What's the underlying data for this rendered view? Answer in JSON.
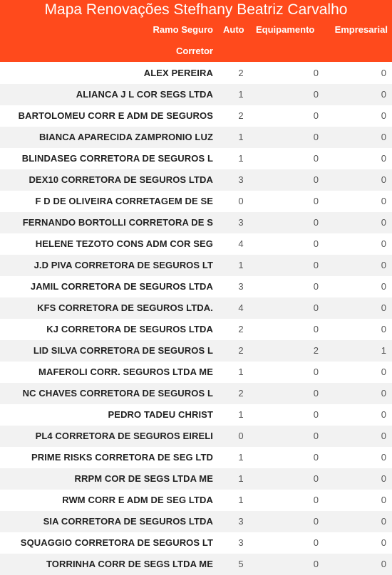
{
  "title": "Mapa Renovações Stefhany Beatriz Carvalho",
  "colors": {
    "accent": "#ff4a1c",
    "row_alt": "#f2f2f2"
  },
  "header": {
    "ramo": "Ramo Seguro",
    "auto": "Auto",
    "equipamento": "Equipamento",
    "empresarial": "Empresarial",
    "corretor": "Corretor"
  },
  "rows": [
    {
      "corretor": "ALEX PEREIRA",
      "auto": "2",
      "equipamento": "0",
      "empresarial": "0"
    },
    {
      "corretor": "ALIANCA J L COR SEGS LTDA",
      "auto": "1",
      "equipamento": "0",
      "empresarial": "0"
    },
    {
      "corretor": "BARTOLOMEU CORR E ADM DE SEGUROS",
      "auto": "2",
      "equipamento": "0",
      "empresarial": "0"
    },
    {
      "corretor": "BIANCA APARECIDA ZAMPRONIO LUZ",
      "auto": "1",
      "equipamento": "0",
      "empresarial": "0"
    },
    {
      "corretor": "BLINDASEG CORRETORA DE SEGUROS L",
      "auto": "1",
      "equipamento": "0",
      "empresarial": "0"
    },
    {
      "corretor": "DEX10 CORRETORA DE SEGUROS LTDA",
      "auto": "3",
      "equipamento": "0",
      "empresarial": "0"
    },
    {
      "corretor": "F D DE OLIVEIRA CORRETAGEM DE SE",
      "auto": "0",
      "equipamento": "0",
      "empresarial": "0"
    },
    {
      "corretor": "FERNANDO BORTOLLI CORRETORA DE S",
      "auto": "3",
      "equipamento": "0",
      "empresarial": "0"
    },
    {
      "corretor": "HELENE TEZOTO CONS ADM COR SEG",
      "auto": "4",
      "equipamento": "0",
      "empresarial": "0"
    },
    {
      "corretor": "J.D PIVA CORRETORA DE SEGUROS LT",
      "auto": "1",
      "equipamento": "0",
      "empresarial": "0"
    },
    {
      "corretor": "JAMIL CORRETORA DE SEGUROS LTDA",
      "auto": "3",
      "equipamento": "0",
      "empresarial": "0"
    },
    {
      "corretor": "KFS CORRETORA DE SEGUROS LTDA.",
      "auto": "4",
      "equipamento": "0",
      "empresarial": "0"
    },
    {
      "corretor": "KJ CORRETORA DE SEGUROS LTDA",
      "auto": "2",
      "equipamento": "0",
      "empresarial": "0"
    },
    {
      "corretor": "LID SILVA CORRETORA DE SEGUROS L",
      "auto": "2",
      "equipamento": "2",
      "empresarial": "1"
    },
    {
      "corretor": "MAFEROLI CORR. SEGUROS LTDA ME",
      "auto": "1",
      "equipamento": "0",
      "empresarial": "0"
    },
    {
      "corretor": "NC CHAVES CORRETORA DE SEGUROS L",
      "auto": "2",
      "equipamento": "0",
      "empresarial": "0"
    },
    {
      "corretor": "PEDRO TADEU CHRIST",
      "auto": "1",
      "equipamento": "0",
      "empresarial": "0"
    },
    {
      "corretor": "PL4 CORRETORA DE SEGUROS EIRELI",
      "auto": "0",
      "equipamento": "0",
      "empresarial": "0"
    },
    {
      "corretor": "PRIME RISKS CORRETORA DE SEG LTD",
      "auto": "1",
      "equipamento": "0",
      "empresarial": "0"
    },
    {
      "corretor": "RRPM COR DE SEGS LTDA ME",
      "auto": "1",
      "equipamento": "0",
      "empresarial": "0"
    },
    {
      "corretor": "RWM CORR E ADM DE SEG LTDA",
      "auto": "1",
      "equipamento": "0",
      "empresarial": "0"
    },
    {
      "corretor": "SIA CORRETORA DE SEGUROS LTDA",
      "auto": "3",
      "equipamento": "0",
      "empresarial": "0"
    },
    {
      "corretor": "SQUAGGIO CORRETORA DE SEGUROS LT",
      "auto": "3",
      "equipamento": "0",
      "empresarial": "0"
    },
    {
      "corretor": "TORRINHA CORR DE SEGS LTDA ME",
      "auto": "5",
      "equipamento": "0",
      "empresarial": "0"
    }
  ]
}
